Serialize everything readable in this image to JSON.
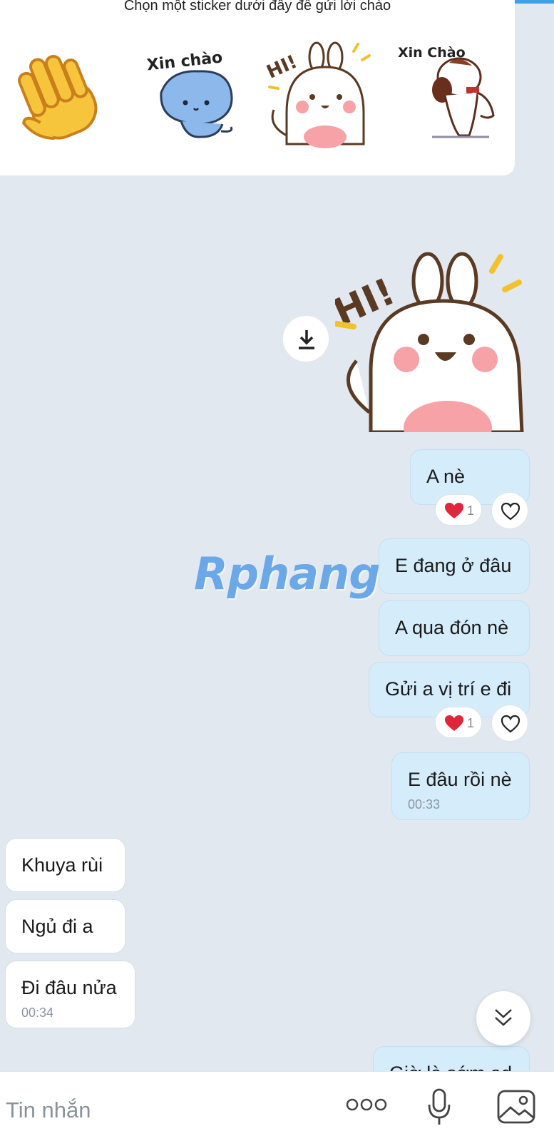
{
  "sticker_panel": {
    "hint": "Chọn một sticker dưới đây để gửi lời chào",
    "stickers": [
      {
        "icon": "waving-hand-icon"
      },
      {
        "icon": "xin-chao-cat-sticker",
        "caption": "Xin chào"
      },
      {
        "icon": "hi-bunny-sticker",
        "caption": "HI!"
      },
      {
        "icon": "xin-chao-dog-sticker",
        "caption": "Xin Chào"
      }
    ]
  },
  "sent_sticker": {
    "caption": "HI!",
    "icon": "hi-bunny-sticker"
  },
  "messages_me": [
    {
      "text": "A nè"
    },
    {
      "text": "E đang ở đâu"
    },
    {
      "text": "A qua đón nè"
    },
    {
      "text": "Gửi a vị trí e đi"
    },
    {
      "text": "E đâu rồi nè",
      "time": "00:33"
    },
    {
      "text": "Giờ là sớm ad"
    }
  ],
  "messages_them": [
    {
      "text": "Khuya rùi"
    },
    {
      "text": "Ngủ đi a"
    },
    {
      "text": "Đi đâu nửa",
      "time": "00:34"
    }
  ],
  "reactions": [
    {
      "emoji": "heart-icon",
      "count": "1"
    },
    {
      "emoji": "heart-icon",
      "count": "1"
    }
  ],
  "watermark": "Rphang",
  "composer": {
    "placeholder": "Tin nhắn"
  },
  "colors": {
    "bubble_me": "#d5ecfb",
    "bubble_them": "#ffffff",
    "background": "#e2e8ef",
    "heart": "#e0263a"
  }
}
